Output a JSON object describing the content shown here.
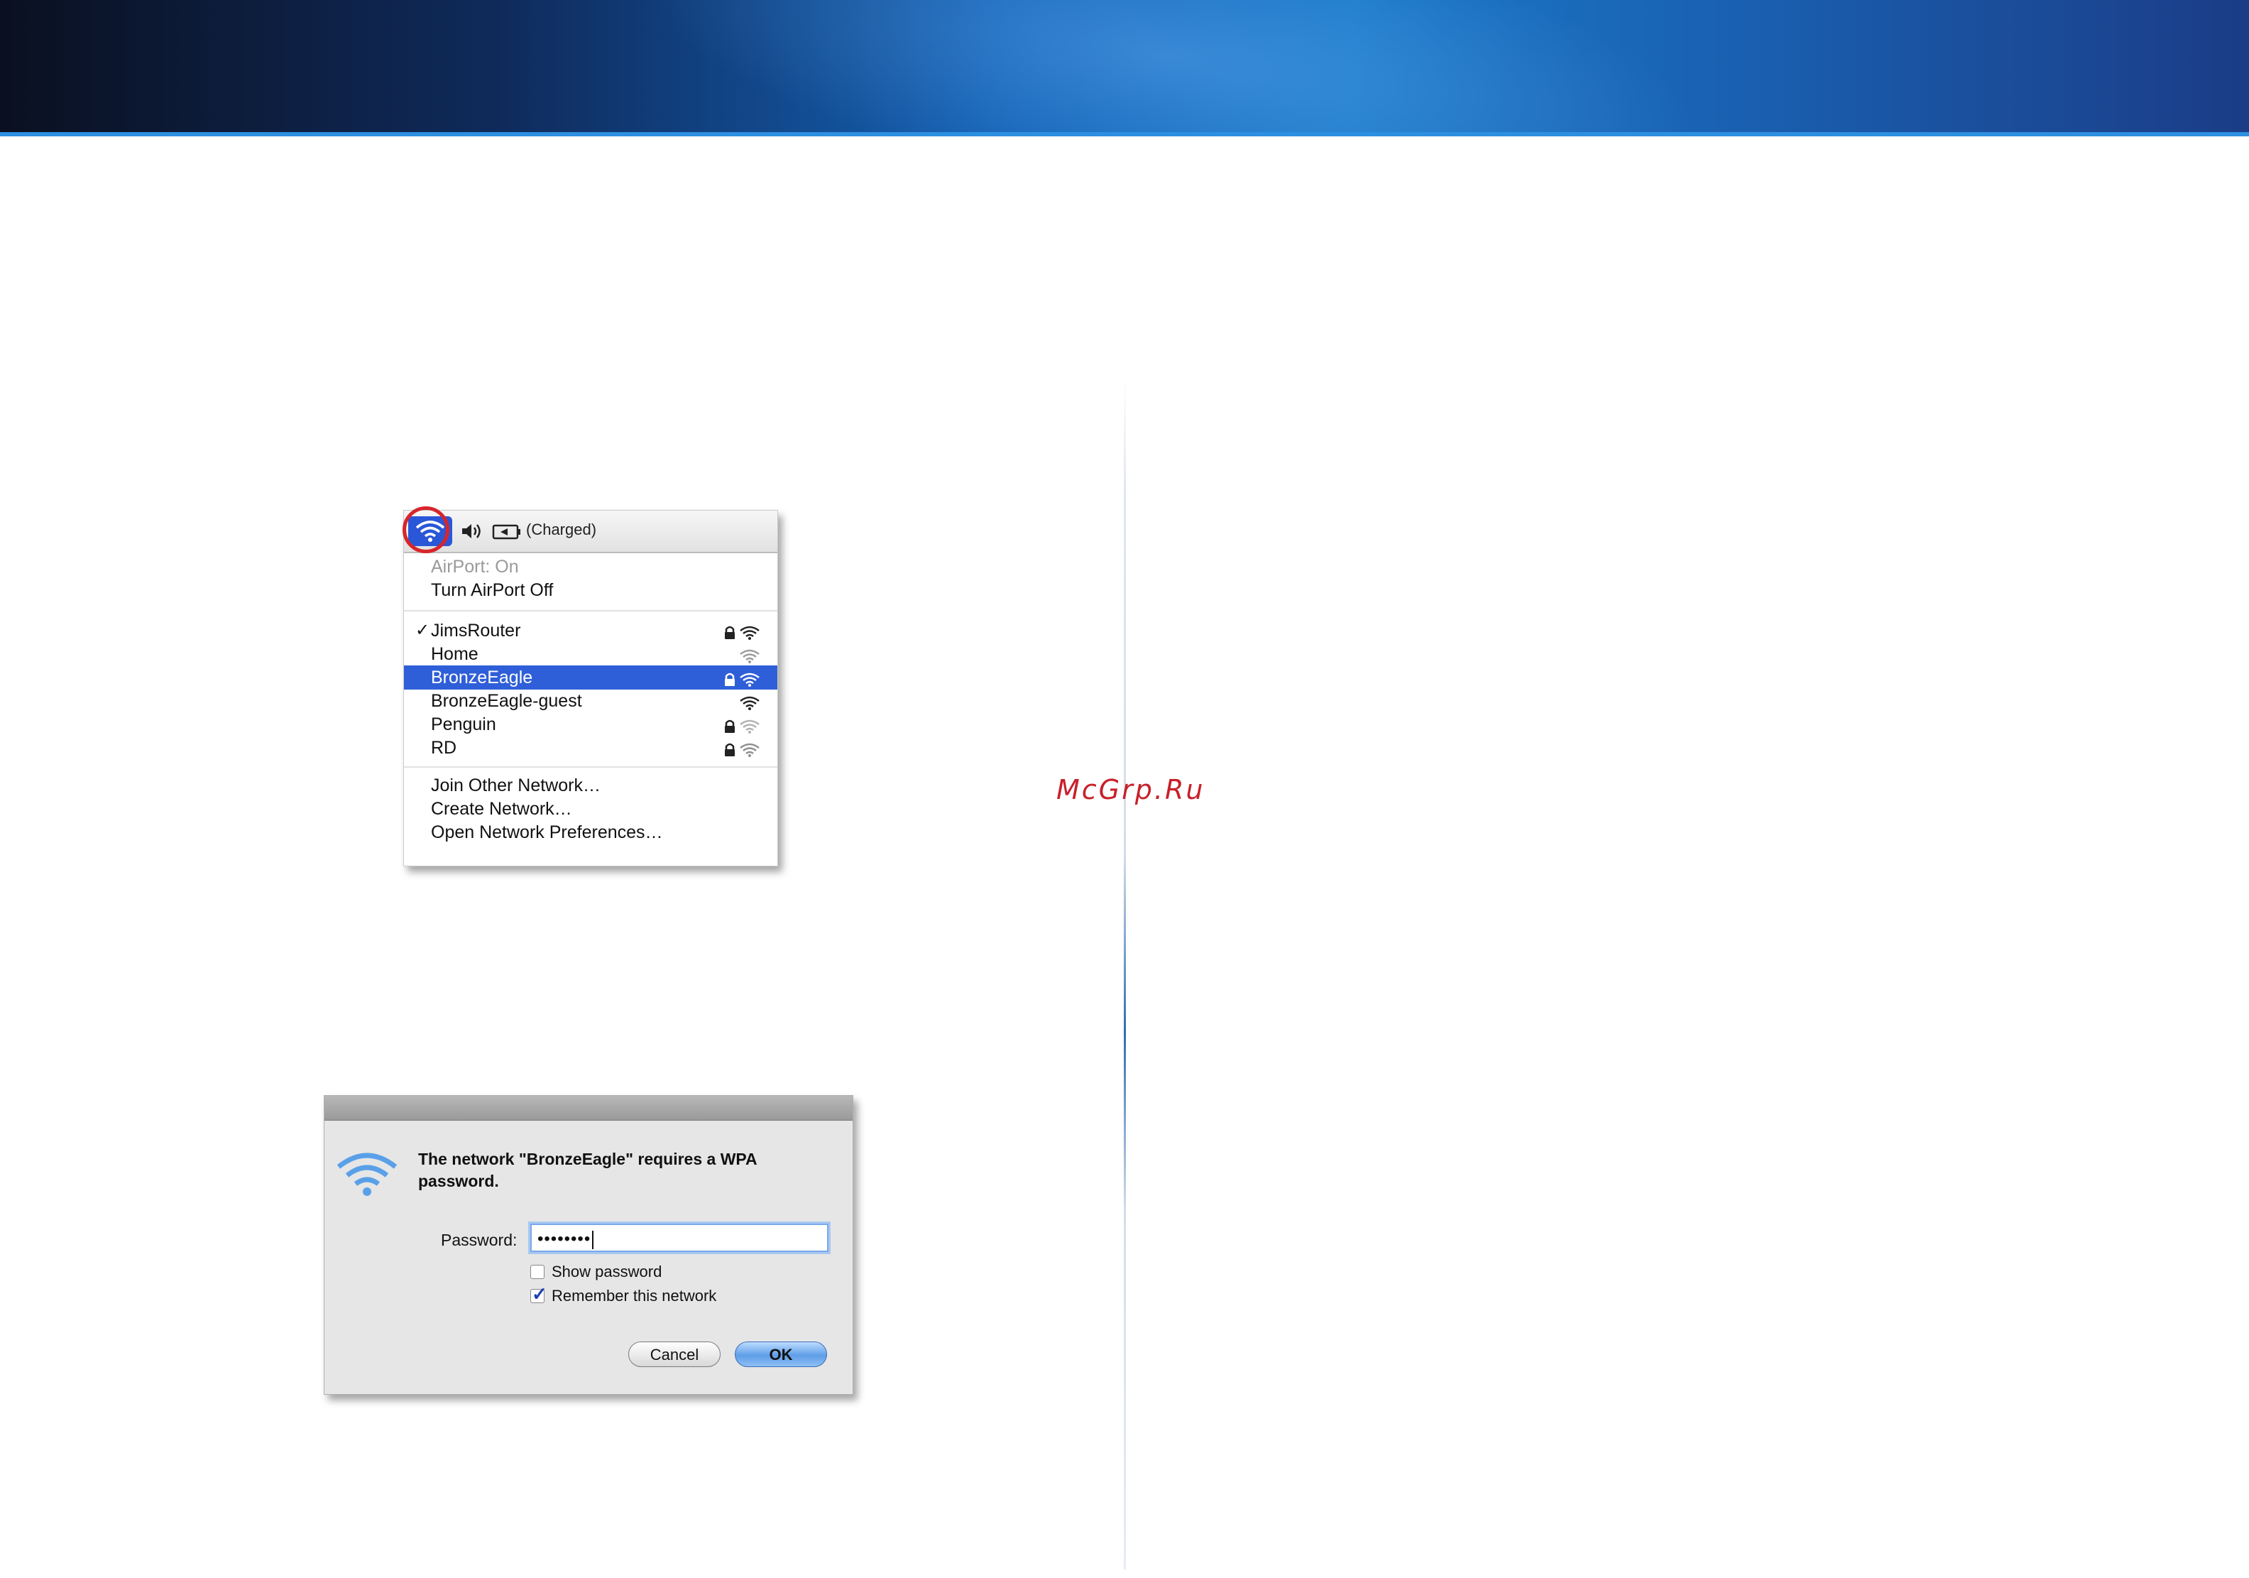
{
  "watermark": "McGrp.Ru",
  "airport_menu": {
    "battery_status": "(Charged)",
    "status_item": "AirPort: On",
    "toggle_item": "Turn AirPort Off",
    "networks": [
      {
        "name": "JimsRouter",
        "checked": true,
        "locked": true,
        "selected": false
      },
      {
        "name": "Home",
        "checked": false,
        "locked": false,
        "selected": false
      },
      {
        "name": "BronzeEagle",
        "checked": false,
        "locked": true,
        "selected": true
      },
      {
        "name": "BronzeEagle-guest",
        "checked": false,
        "locked": false,
        "selected": false
      },
      {
        "name": "Penguin",
        "checked": false,
        "locked": true,
        "selected": false
      },
      {
        "name": "RD",
        "checked": false,
        "locked": true,
        "selected": false
      }
    ],
    "check_glyph": "✓",
    "actions": [
      "Join Other Network…",
      "Create Network…",
      "Open Network Preferences…"
    ],
    "highlight_color": "#d8252b",
    "selection_color": "#2f5fd8"
  },
  "dialog": {
    "message_line1": "The network \"BronzeEagle\" requires a WPA",
    "message_line2": "password.",
    "password_label": "Password:",
    "password_value": "••••••••",
    "show_password_label": "Show password",
    "show_password_checked": false,
    "remember_label": "Remember this network",
    "remember_checked": true,
    "cancel_label": "Cancel",
    "ok_label": "OK"
  }
}
